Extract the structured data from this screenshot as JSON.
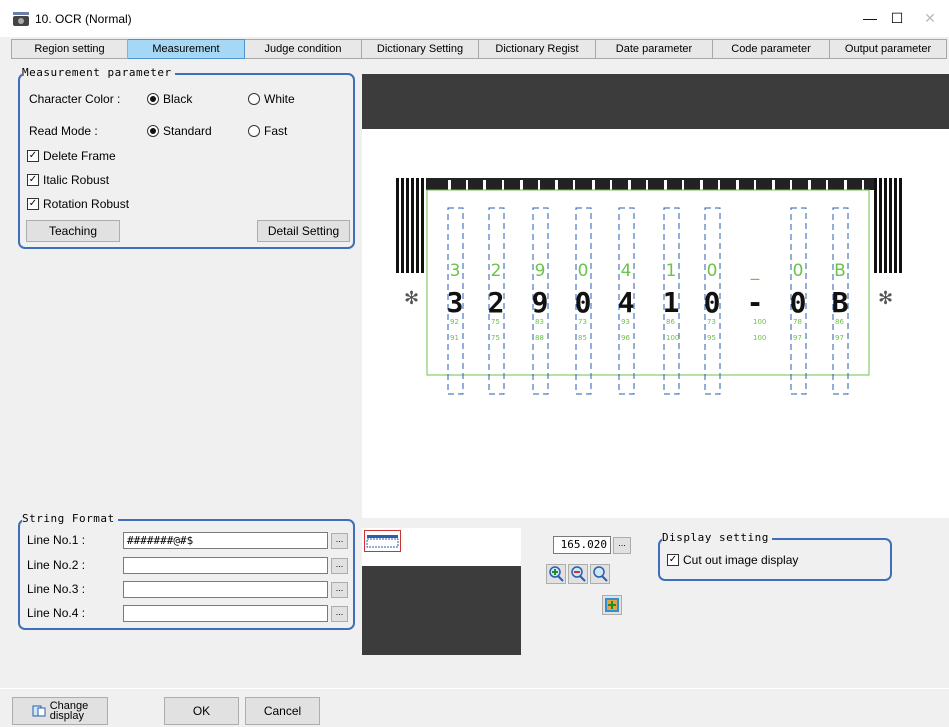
{
  "window": {
    "title": "10. OCR (Normal)",
    "minimize_glyph": "—",
    "maximize_glyph": "☐",
    "close_glyph": "✕",
    "app_icon": "camera-icon"
  },
  "tabs": [
    {
      "label": "Region setting"
    },
    {
      "label": "Measurement"
    },
    {
      "label": "Judge condition"
    },
    {
      "label": "Dictionary Setting"
    },
    {
      "label": "Dictionary Regist"
    },
    {
      "label": "Date parameter"
    },
    {
      "label": "Code parameter"
    },
    {
      "label": "Output parameter"
    }
  ],
  "active_tab": "Measurement",
  "measurement": {
    "group_title": "Measurement parameter",
    "character_color_label": "Character Color :",
    "color_black": "Black",
    "color_white": "White",
    "read_mode_label": "Read Mode :",
    "mode_standard": "Standard",
    "mode_fast": "Fast",
    "delete_frame": "Delete Frame",
    "italic_robust": "Italic Robust",
    "rotation_robust": "Rotation Robust",
    "teaching_button": "Teaching",
    "detail_button": "Detail Setting"
  },
  "string_format": {
    "group_title": "String Format",
    "lines": [
      {
        "label": "Line No.1 :",
        "value": "#######@#$"
      },
      {
        "label": "Line No.2 :",
        "value": ""
      },
      {
        "label": "Line No.3 :",
        "value": ""
      },
      {
        "label": "Line No.4 :",
        "value": ""
      }
    ],
    "dots_label": "..."
  },
  "ocr": {
    "read_chars": [
      "3",
      "2",
      "9",
      "0",
      "4",
      "1",
      "0",
      "_",
      "0",
      "B"
    ],
    "line1_scores": [
      "92",
      "75",
      "83",
      "73",
      "93",
      "86",
      "73",
      "100",
      "78",
      "86"
    ],
    "line2_scores": [
      "91",
      "75",
      "88",
      "85",
      "96",
      "100",
      "95",
      "100",
      "97",
      "97"
    ],
    "asterisk": "✻"
  },
  "zoom": {
    "value": "165.020",
    "dots_label": "..."
  },
  "display_setting": {
    "group_title": "Display setting",
    "cut_out": "Cut out image display"
  },
  "bottom": {
    "change_display": "Change\ndisplay",
    "ok": "OK",
    "cancel": "Cancel"
  },
  "colors": {
    "accent_blue": "#3f6fb8",
    "tab_active": "#a6d8f5",
    "ocr_green": "#6cc24a",
    "roi_blue": "#2a5db0"
  }
}
